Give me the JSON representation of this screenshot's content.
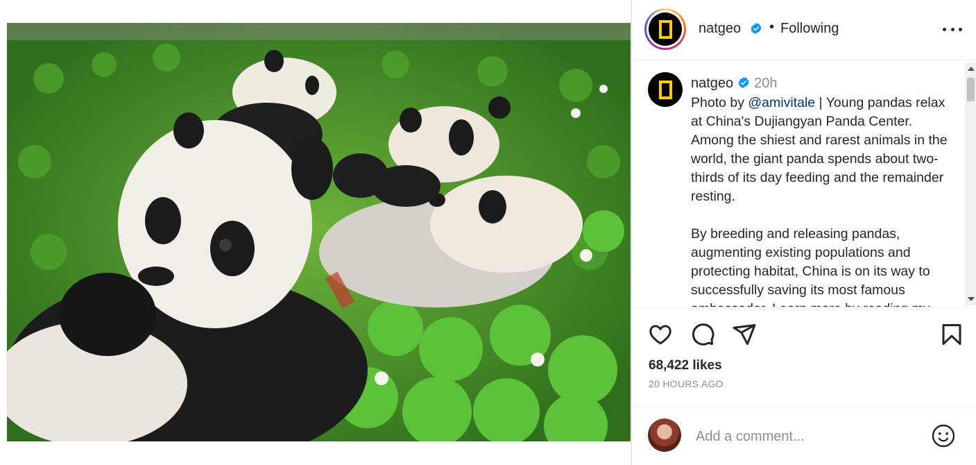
{
  "post": {
    "image_alt": "Young pandas relaxing in clover"
  },
  "header": {
    "username": "natgeo",
    "separator": "•",
    "follow_status": "Following"
  },
  "caption": {
    "username": "natgeo",
    "time": "20h",
    "prefix": "Photo by ",
    "mention": "@amivitale",
    "paragraph1_rest": " | Young pandas relax at China's Dujiangyan Panda Center. Among the shiest and rarest animals in the world, the giant panda spends about two-thirds of its day feeding and the remainder resting.",
    "paragraph2": "By breeding and releasing pandas, augmenting existing populations and protecting habitat, China is on its way to successfully saving its most famous ambassador. Learn more by reading my"
  },
  "actions": {
    "likes": "68,422 likes",
    "timestamp": "20 HOURS AGO"
  },
  "comment": {
    "placeholder": "Add a comment..."
  },
  "colors": {
    "verified": "#0095f6",
    "ring_start": "#feda75",
    "ring_end": "#d62976",
    "logo_yellow": "#ffce00",
    "mention": "#00376b"
  },
  "icons": [
    "heart-icon",
    "comment-icon",
    "share-icon",
    "bookmark-icon",
    "more-icon",
    "emoji-icon",
    "verified-icon"
  ]
}
